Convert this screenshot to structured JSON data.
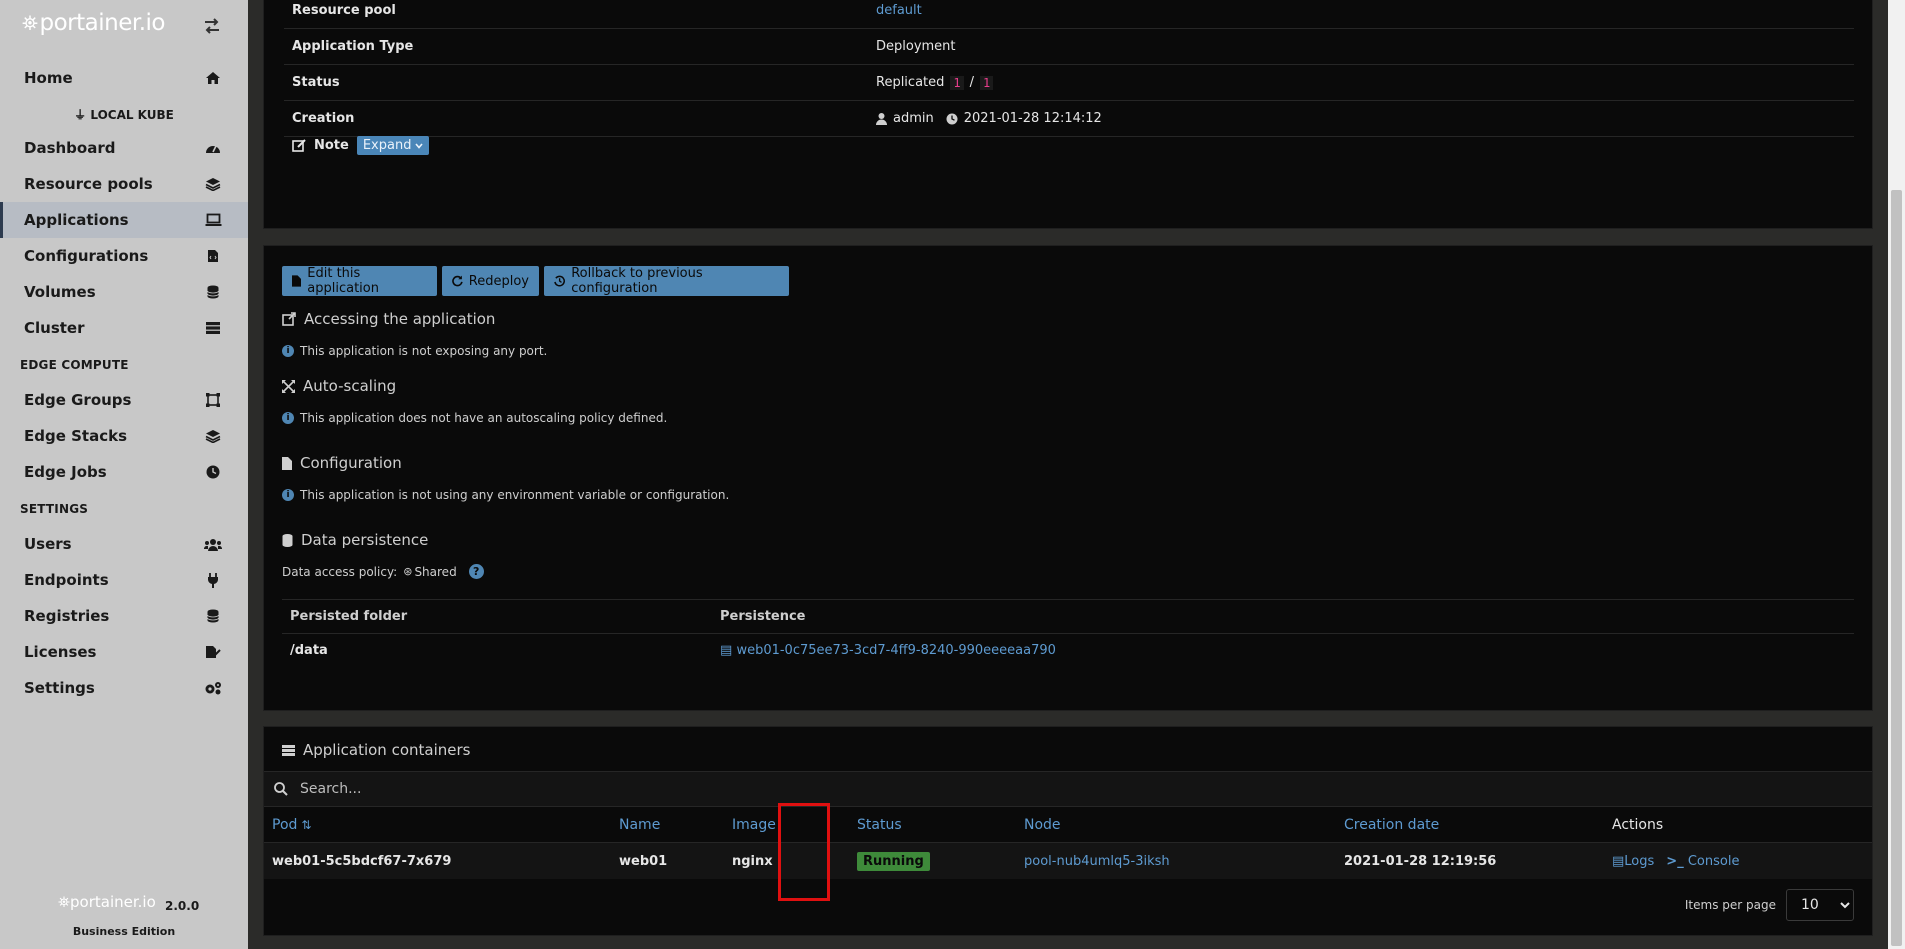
{
  "app": {
    "logo_text": "portainer.io",
    "version": "2.0.0",
    "edition": "Business Edition"
  },
  "sidebar": {
    "home": "Home",
    "endpoint": "LOCAL KUBE",
    "items": [
      {
        "label": "Dashboard",
        "icon": "tachometer-icon"
      },
      {
        "label": "Resource pools",
        "icon": "layers-icon"
      },
      {
        "label": "Applications",
        "icon": "laptop-code-icon",
        "active": true
      },
      {
        "label": "Configurations",
        "icon": "file-code-icon"
      },
      {
        "label": "Volumes",
        "icon": "database-icon"
      },
      {
        "label": "Cluster",
        "icon": "server-icon"
      }
    ],
    "edge_section": "EDGE COMPUTE",
    "edge_items": [
      {
        "label": "Edge Groups",
        "icon": "object-group-icon"
      },
      {
        "label": "Edge Stacks",
        "icon": "layers-icon"
      },
      {
        "label": "Edge Jobs",
        "icon": "clock-icon"
      }
    ],
    "settings_section": "SETTINGS",
    "settings_items": [
      {
        "label": "Users",
        "icon": "users-icon"
      },
      {
        "label": "Endpoints",
        "icon": "plug-icon"
      },
      {
        "label": "Registries",
        "icon": "database-icon"
      },
      {
        "label": "Licenses",
        "icon": "file-signature-icon"
      },
      {
        "label": "Settings",
        "icon": "cogs-icon"
      }
    ]
  },
  "details": {
    "rows": [
      {
        "key": "Resource pool",
        "value": "default"
      },
      {
        "key": "Application Type",
        "value": "Deployment"
      },
      {
        "key": "Status",
        "value_prefix": "Replicated",
        "value_a": "1",
        "value_sep": "/",
        "value_b": "1"
      },
      {
        "key": "Creation",
        "user": "admin",
        "timestamp": "2021-01-28 12:14:12"
      }
    ],
    "note_label": "Note",
    "note_button": "Expand"
  },
  "actions": {
    "edit": "Edit this application",
    "redeploy": "Redeploy",
    "rollback": "Rollback to previous configuration"
  },
  "sections": {
    "accessing_title": "Accessing the application",
    "accessing_info": "This application is not exposing any port.",
    "autoscaling_title": "Auto-scaling",
    "autoscaling_info": "This application does not have an autoscaling policy defined.",
    "configuration_title": "Configuration",
    "configuration_info": "This application is not using any environment variable or configuration.",
    "persistence_title": "Data persistence",
    "access_policy_label": "Data access policy:",
    "access_policy_value": "Shared"
  },
  "persistence_table": {
    "headers": [
      "Persisted folder",
      "Persistence"
    ],
    "rows": [
      {
        "folder": "/data",
        "volume": "web01-0c75ee73-3cd7-4ff9-8240-990eeeeaa790"
      }
    ]
  },
  "containers": {
    "title": "Application containers",
    "search_placeholder": "Search...",
    "headers": {
      "pod": "Pod",
      "name": "Name",
      "image": "Image",
      "status": "Status",
      "node": "Node",
      "creation": "Creation date",
      "actions": "Actions"
    },
    "rows": [
      {
        "pod": "web01-5c5bdcf67-7x679",
        "name": "web01",
        "image": "nginx",
        "status": "Running",
        "node": "pool-nub4umlq5-3iksh",
        "creation": "2021-01-28 12:19:56",
        "logs": "Logs",
        "console": "Console"
      }
    ],
    "items_per_page_label": "Items per page",
    "items_per_page_value": "10"
  },
  "colors": {
    "accent": "#5e9bd1",
    "button": "#4f86b3",
    "running": "#3e8a3a",
    "highlight": "#e01010"
  }
}
